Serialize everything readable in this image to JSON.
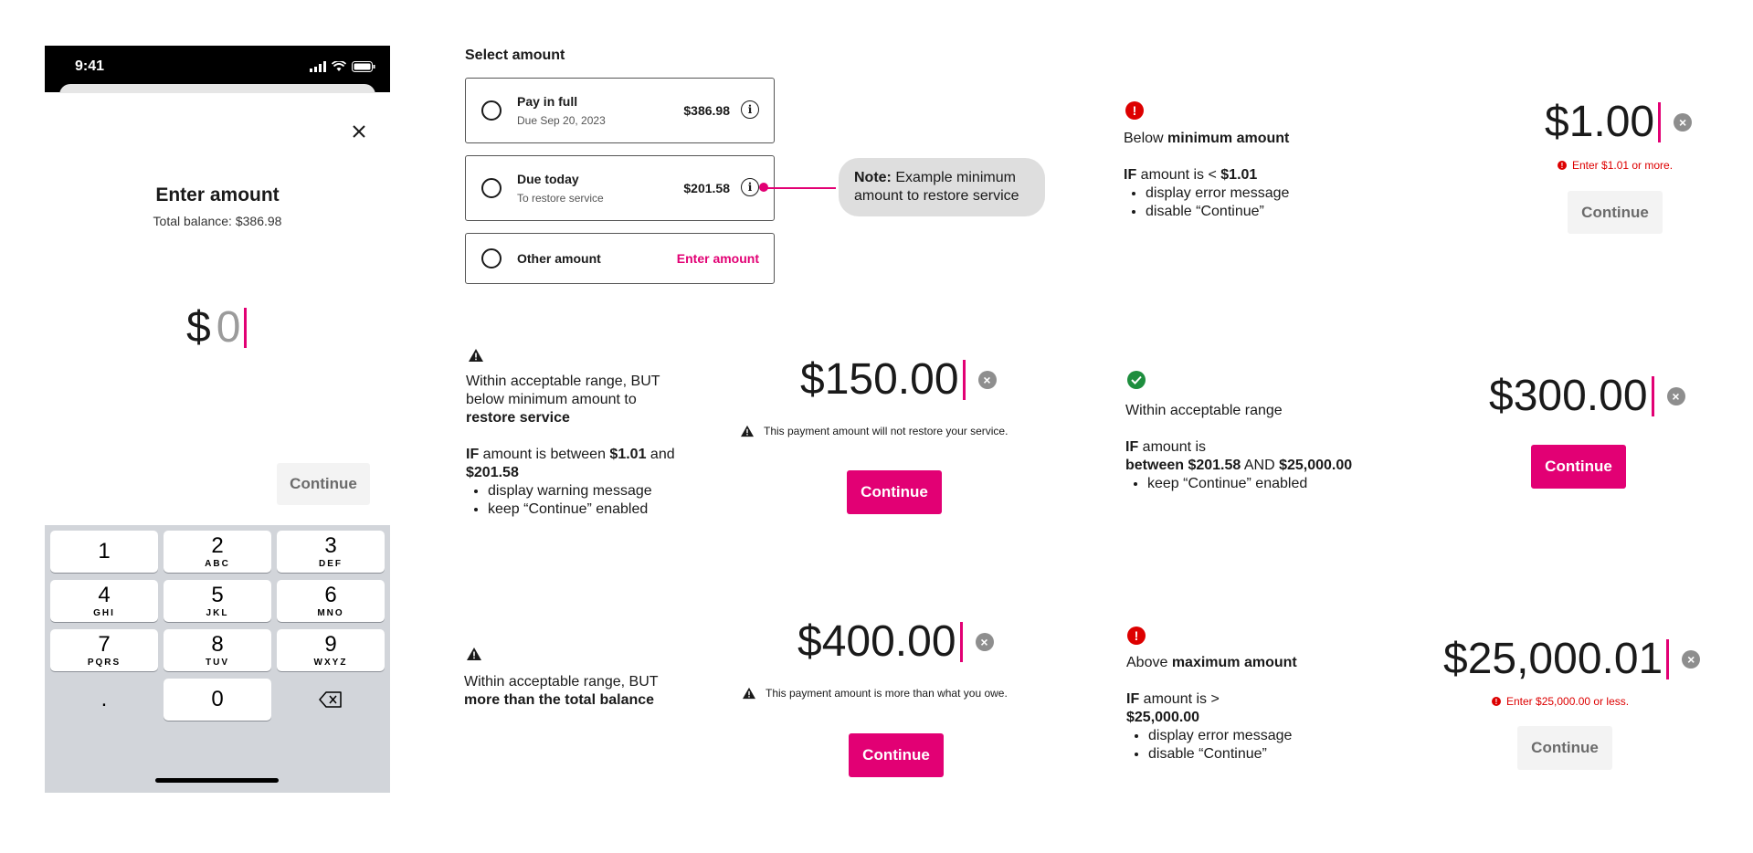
{
  "phone": {
    "time": "9:41",
    "title": "Enter amount",
    "subtitle": "Total balance: $386.98",
    "currency": "$",
    "amount_placeholder": "0",
    "continue_label": "Continue",
    "keys": [
      {
        "num": "1",
        "letters": ""
      },
      {
        "num": "2",
        "letters": "ABC"
      },
      {
        "num": "3",
        "letters": "DEF"
      },
      {
        "num": "4",
        "letters": "GHI"
      },
      {
        "num": "5",
        "letters": "JKL"
      },
      {
        "num": "6",
        "letters": "MNO"
      },
      {
        "num": "7",
        "letters": "PQRS"
      },
      {
        "num": "8",
        "letters": "TUV"
      },
      {
        "num": "9",
        "letters": "WXYZ"
      },
      {
        "num": ".",
        "letters": ""
      },
      {
        "num": "0",
        "letters": ""
      }
    ]
  },
  "select_amount": {
    "title": "Select amount",
    "options": [
      {
        "label": "Pay in full",
        "sub": "Due Sep 20, 2023",
        "amount": "$386.98"
      },
      {
        "label": "Due today",
        "sub": "To restore service",
        "amount": "$201.58"
      },
      {
        "label": "Other amount",
        "action": "Enter amount"
      }
    ],
    "note_bold": "Note:",
    "note_text": " Example minimum amount to restore service"
  },
  "rules": {
    "below_min": {
      "line1_a": "Below ",
      "line1_b": "minimum amount",
      "if": "IF",
      "cond_a": " amount is < ",
      "cond_b": "$1.01",
      "bullets": [
        "display error message",
        "disable “Continue”"
      ],
      "demo_amount": "$1.00",
      "error_text": "Enter $1.01 or more.",
      "continue_label": "Continue"
    },
    "below_restore": {
      "line1": "Within acceptable range, BUT below minimum amount to ",
      "line1_b": "restore service",
      "if": "IF",
      "cond_a": " amount is between ",
      "cond_b": "$1.01",
      "cond_c": " and ",
      "cond_d": "$201.58",
      "bullets": [
        "display warning message",
        "keep “Continue” enabled"
      ],
      "demo_amount": "$150.00",
      "warning_text": "This payment amount will not restore your service.",
      "continue_label": "Continue"
    },
    "acceptable": {
      "line1": "Within acceptable range",
      "if": "IF",
      "cond_a": " amount is",
      "cond_b": "between $201.58",
      "cond_c": " AND ",
      "cond_d": "$25,000.00",
      "bullets": [
        "keep “Continue” enabled"
      ],
      "demo_amount": "$300.00",
      "continue_label": "Continue"
    },
    "over_balance": {
      "line1": "Within acceptable range, BUT",
      "line2": "more than the total balance",
      "demo_amount": "$400.00",
      "warning_text": "This payment amount is more than what you owe.",
      "continue_label": "Continue"
    },
    "above_max": {
      "line1_a": "Above ",
      "line1_b": "maximum amount",
      "if": "IF",
      "cond_a": " amount is >",
      "cond_b": "$25,000.00",
      "bullets": [
        "display error message",
        "disable “Continue”"
      ],
      "demo_amount": "$25,000.01",
      "error_text": "Enter $25,000.00 or less.",
      "continue_label": "Continue"
    }
  },
  "colors": {
    "accent": "#e20074",
    "error": "#dd0000",
    "success": "#1e8e3e"
  },
  "icons": [
    "close-icon",
    "info-icon",
    "warning-icon",
    "error-icon",
    "check-icon",
    "clear-icon",
    "backspace-icon",
    "signal-icon",
    "wifi-icon",
    "battery-icon"
  ]
}
